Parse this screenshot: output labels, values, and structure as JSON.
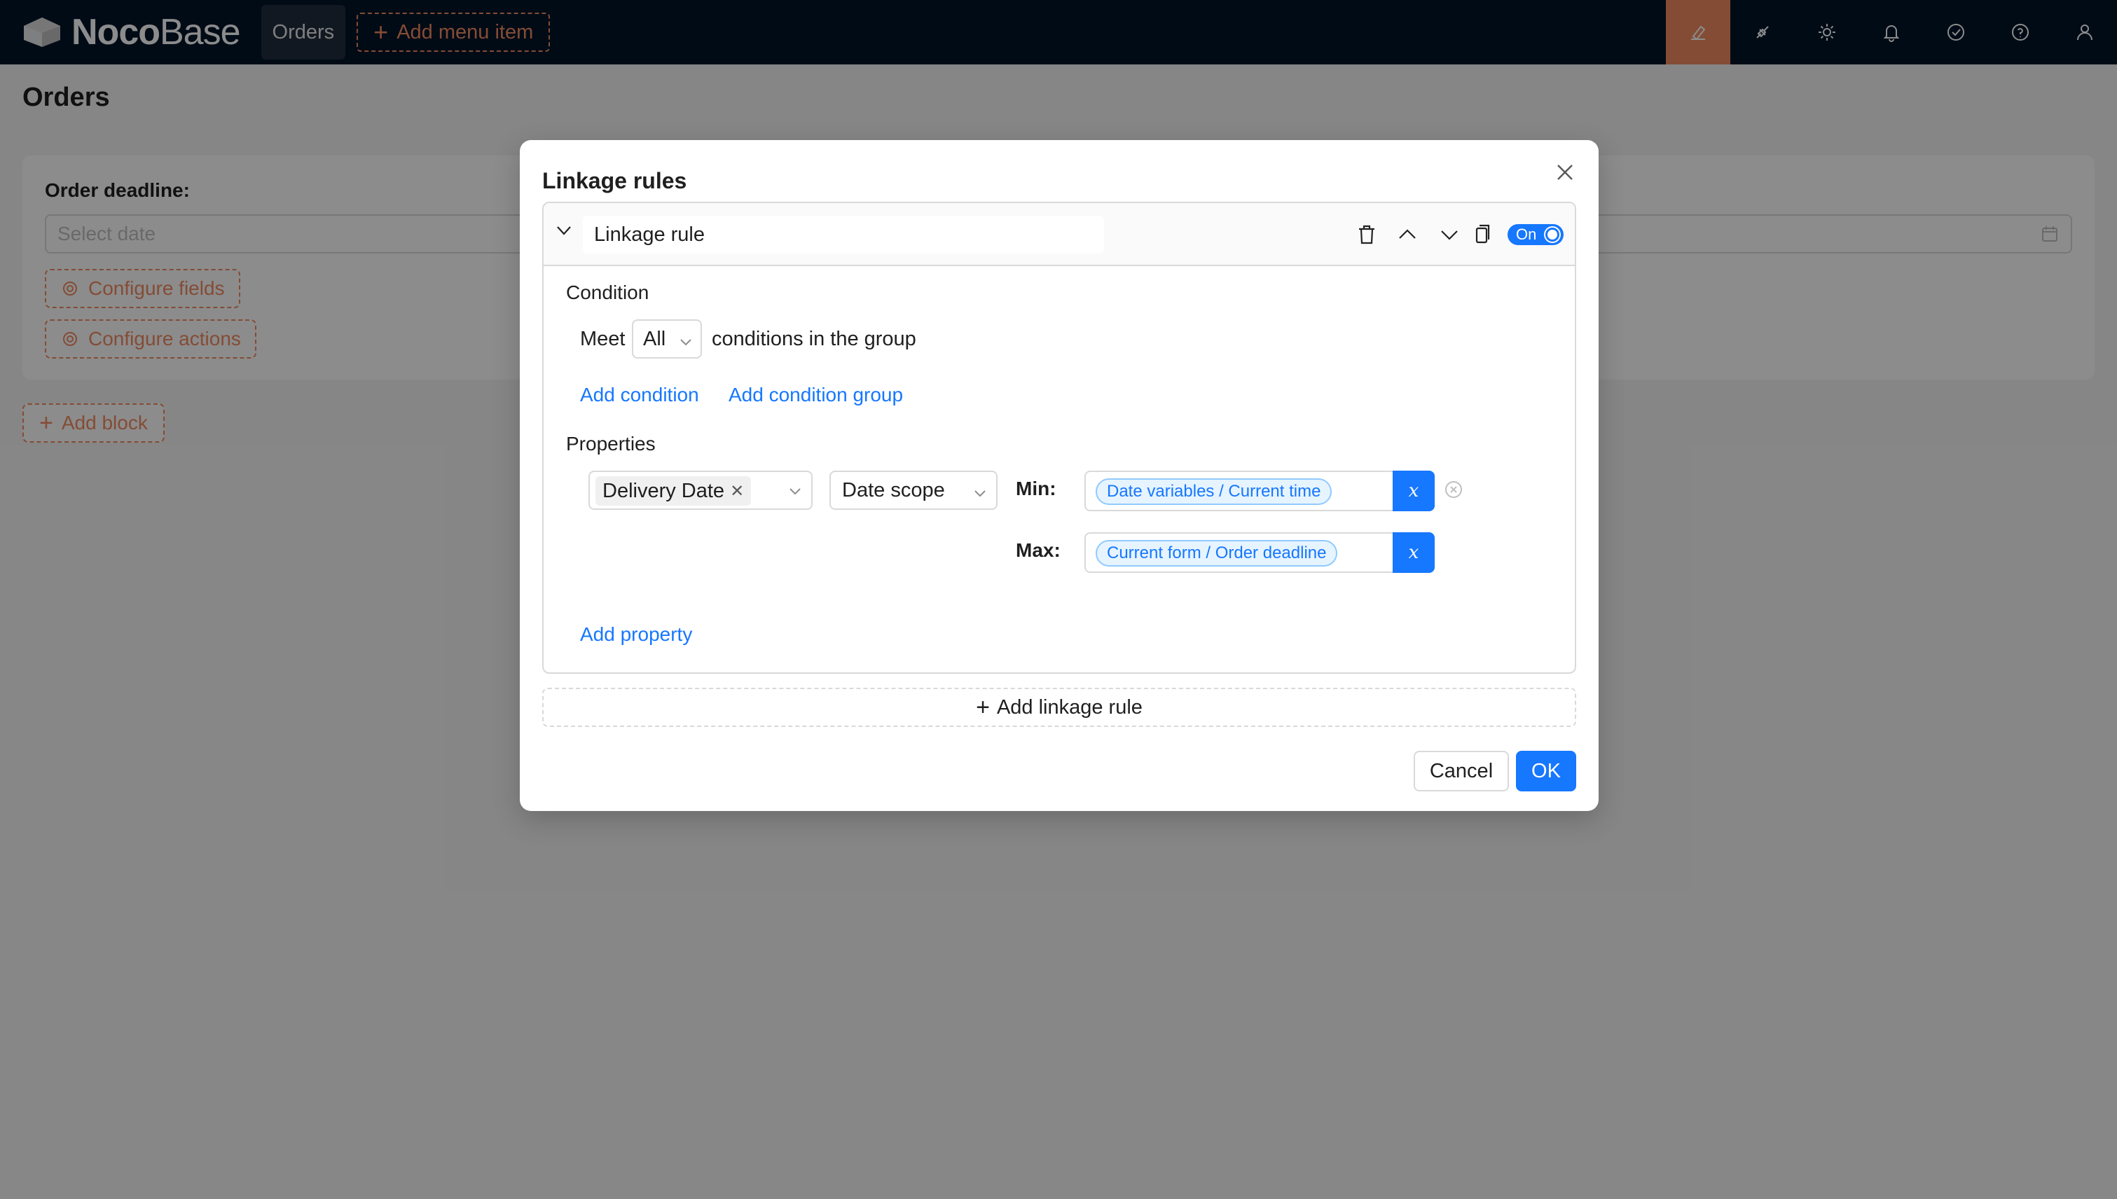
{
  "app": {
    "logo_bold": "Noco",
    "logo_light": "Base",
    "menu_orders": "Orders",
    "add_menu_item": "Add menu item",
    "top_icons": [
      "ui-editor-icon",
      "plugin-icon",
      "settings-icon",
      "bell-icon",
      "check-circle-icon",
      "help-icon",
      "user-icon"
    ],
    "accent_color": "#f18b62"
  },
  "page": {
    "title": "Orders",
    "field_label": "Order deadline",
    "date_placeholder": "Select date",
    "configure_fields": "Configure fields",
    "configure_actions": "Configure actions",
    "add_block": "Add block"
  },
  "modal": {
    "title": "Linkage rules",
    "rule": {
      "name": "Linkage rule",
      "switch_label": "On",
      "condition_label": "Condition",
      "meet": "Meet",
      "match_option": "All",
      "conditions_text": "conditions in the group",
      "add_condition": "Add condition",
      "add_condition_group": "Add condition group",
      "properties_label": "Properties",
      "property_field": "Delivery Date",
      "property_action": "Date scope",
      "min_label": "Min",
      "min_value": "Date variables / Current time",
      "max_label": "Max",
      "max_value": "Current form / Order deadline",
      "var_symbol": "x",
      "add_property": "Add property"
    },
    "add_linkage_rule": "Add linkage rule",
    "cancel": "Cancel",
    "ok": "OK"
  },
  "colors": {
    "primary": "#1677ff",
    "header_bg": "#001529"
  }
}
